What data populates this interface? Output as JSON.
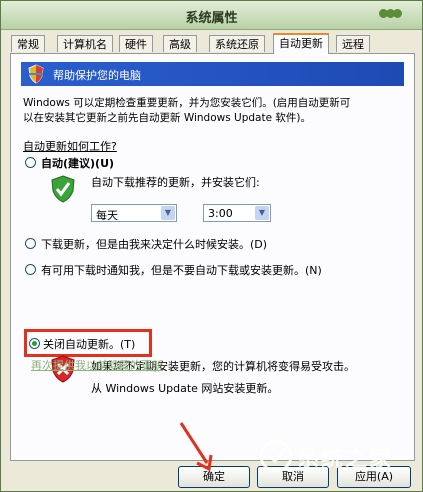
{
  "window": {
    "title": "系统属性"
  },
  "tabs": [
    "常规",
    "计算机名",
    "硬件",
    "高级",
    "系统还原",
    "自动更新",
    "远程"
  ],
  "banner": {
    "text": "帮助保护您的电脑"
  },
  "description": [
    "Windows 可以定期检查重要更新，并为您安装它们。(启用自动更新可",
    "以在安装其它更新之前先自动更新 Windows Update 软件)。"
  ],
  "section_link": "自动更新如何工作?",
  "options": {
    "auto": {
      "label": "自动(建议)(U)",
      "sub": "自动下载推荐的更新，并安装它们:",
      "day": "每天",
      "time": "3:00"
    },
    "download": {
      "label": "下载更新，但是由我来决定什么时候安装。(D)"
    },
    "notify": {
      "label": "有可用下载时通知我，但是不要自动下载或安装更新。(N)"
    },
    "off": {
      "label": "关闭自动更新。(T)",
      "warn1": "如果您不定期安装更新，您的计算机将变得易受攻击。",
      "warn2": "从 Windows Update 网站安装更新。"
    }
  },
  "hidden_updates_link": "再次提供我以前隐藏的更新",
  "buttons": {
    "ok": "确定",
    "cancel": "取消",
    "apply": "应用(A)"
  },
  "watermark": {
    "text": "系统之家"
  }
}
